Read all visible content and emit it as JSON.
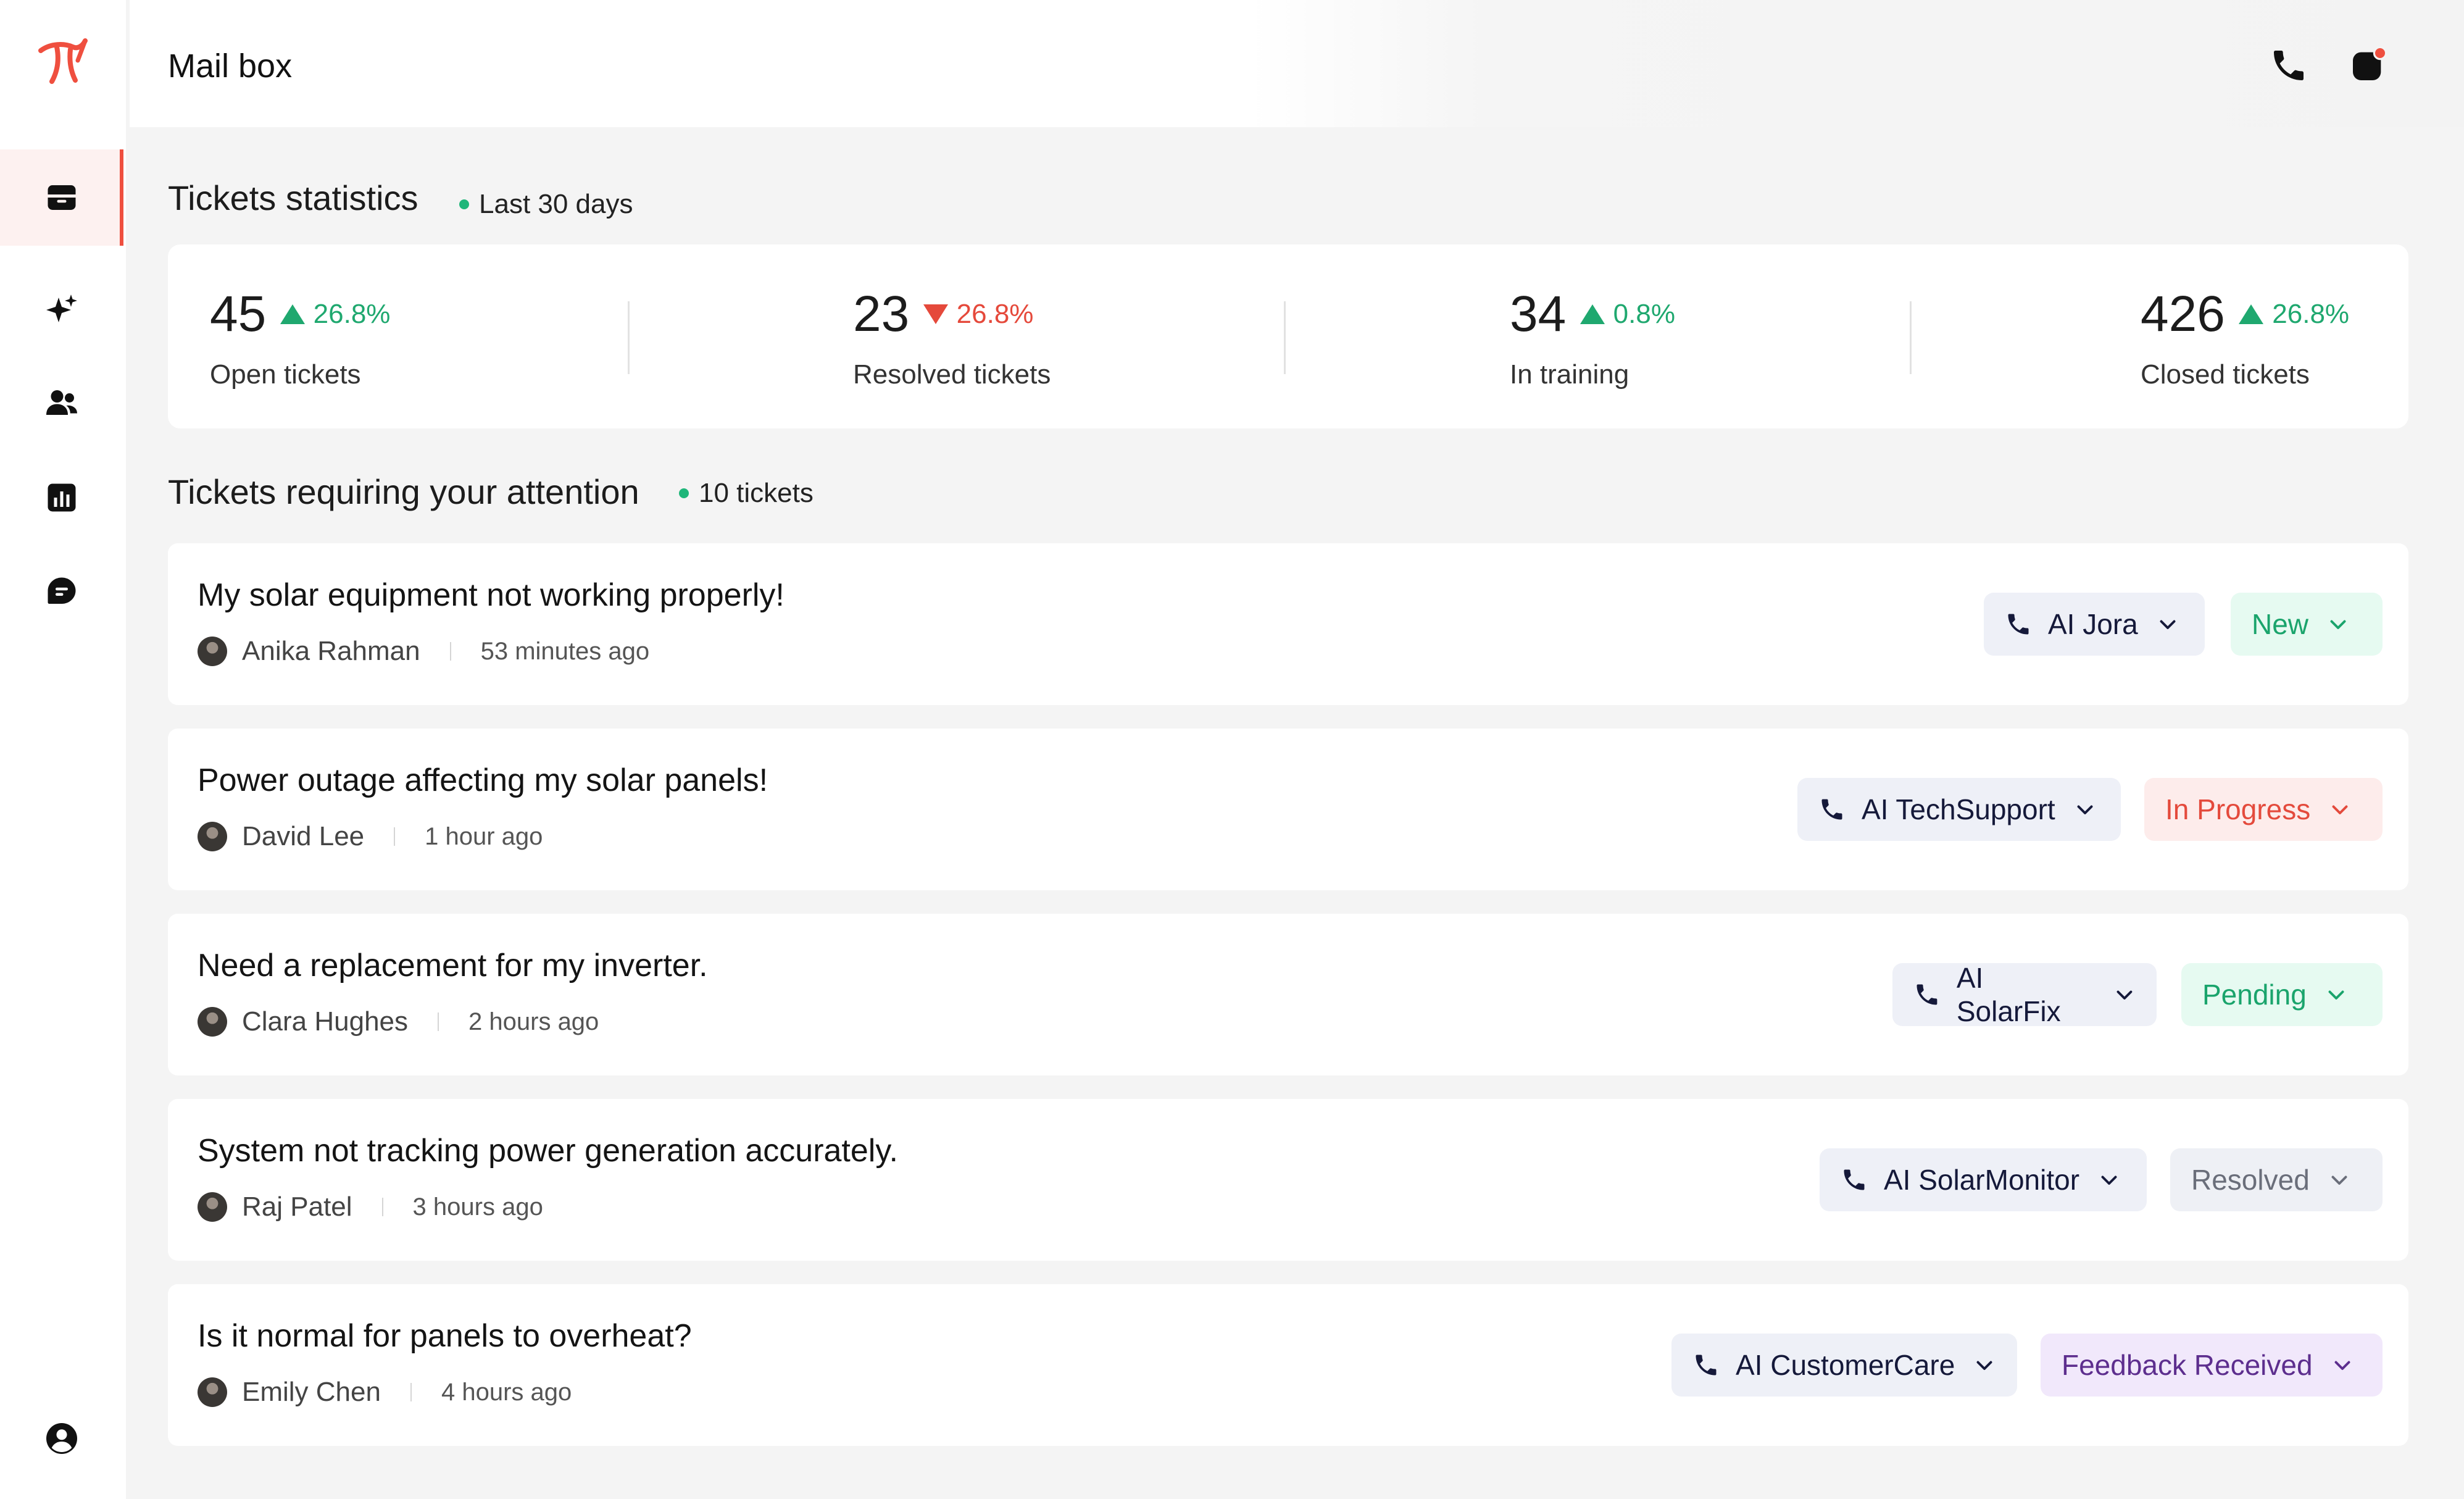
{
  "header": {
    "title": "Mail box"
  },
  "sidebar": {
    "items": [
      {
        "icon": "inbox-icon",
        "active": true
      },
      {
        "icon": "sparkle-icon",
        "active": false
      },
      {
        "icon": "users-icon",
        "active": false
      },
      {
        "icon": "bar-chart-icon",
        "active": false
      },
      {
        "icon": "chat-icon",
        "active": false
      },
      {
        "icon": "user-account-icon",
        "active": false
      }
    ]
  },
  "stats_section": {
    "title": "Tickets statistics",
    "period": "Last 30 days",
    "stats": [
      {
        "value": "45",
        "change": "26.8%",
        "direction": "up",
        "label": "Open tickets"
      },
      {
        "value": "23",
        "change": "26.8%",
        "direction": "down",
        "label": "Resolved tickets"
      },
      {
        "value": "34",
        "change": "0.8%",
        "direction": "up",
        "label": "In training"
      },
      {
        "value": "426",
        "change": "26.8%",
        "direction": "up",
        "label": "Closed tickets"
      }
    ]
  },
  "attention_section": {
    "title": "Tickets requiring your attention",
    "count": "10 tickets"
  },
  "tickets": [
    {
      "title": "My solar equipment not working properly!",
      "customer": "Anika Rahman",
      "time": "53 minutes ago",
      "agent": "AI Jora",
      "status": "New"
    },
    {
      "title": "Power outage affecting my solar panels!",
      "customer": "David Lee",
      "time": "1 hour ago",
      "agent": "AI TechSupport",
      "status": "In Progress"
    },
    {
      "title": "Need a replacement for my inverter.",
      "customer": "Clara Hughes",
      "time": "2 hours ago",
      "agent": "AI SolarFix",
      "status": "Pending"
    },
    {
      "title": "System not tracking power generation accurately.",
      "customer": "Raj Patel",
      "time": "3 hours ago",
      "agent": "AI SolarMonitor",
      "status": "Resolved"
    },
    {
      "title": "Is it normal for panels to overheat?",
      "customer": "Emily Chen",
      "time": "4 hours ago",
      "agent": "AI CustomerCare",
      "status": "Feedback Received"
    }
  ],
  "colors": {
    "accent": "#ef4f3f",
    "positive": "#1fa86f",
    "negative": "#e5493b",
    "status_new": "#1aa46c",
    "status_in_progress": "#e44a3c",
    "status_pending": "#1aa46c",
    "status_resolved": "#6a6e7a",
    "status_feedback": "#5d2e8e"
  }
}
